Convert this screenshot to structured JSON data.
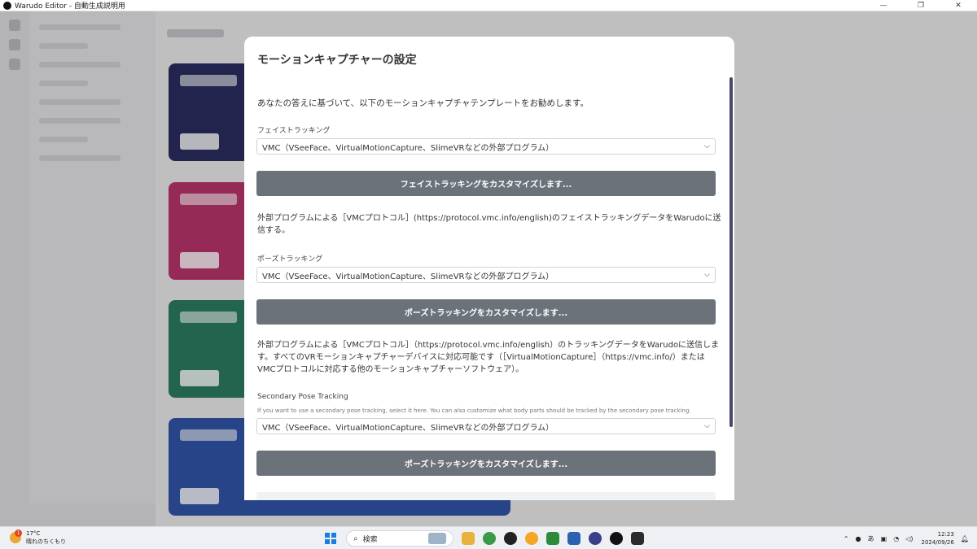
{
  "window": {
    "title": "Warudo Editor - 自動生成説明用",
    "controls": [
      "—",
      "❐",
      "✕"
    ]
  },
  "modal": {
    "title": "モーションキャプチャーの設定",
    "intro": "あなたの答えに基づいて、以下のモーションキャプチャテンプレートをお勧めします。",
    "face": {
      "label": "フェイストラッキング",
      "selected": "VMC（VSeeFace、VirtualMotionCapture、SlimeVRなどの外部プログラム）",
      "button": "フェイストラッキングをカスタマイズします...",
      "description": "外部プログラムによる［VMCプロトコル］(https://protocol.vmc.info/english)のフェイストラッキングデータをWarudoに送信する。"
    },
    "pose": {
      "label": "ポーズトラッキング",
      "selected": "VMC（VSeeFace、VirtualMotionCapture、SlimeVRなどの外部プログラム）",
      "button": "ポーズトラッキングをカスタマイズします...",
      "description": "外部プログラムによる［VMCプロトコル］（https://protocol.vmc.info/english）のトラッキングデータをWarudoに送信します。すべてのVRモーションキャプチャーデバイスに対応可能です（［VirtualMotionCapture］（https://vmc.info/）またはVMCプロトコルに対応する他のモーションキャプチャーソフトウェア）。"
    },
    "secondary": {
      "label": "Secondary Pose Tracking",
      "hint": "If you want to use a secondary pose tracking, select it here. You can also customize what body parts should be tracked by the secondary pose tracking.",
      "selected": "VMC（VSeeFace、VirtualMotionCapture、SlimeVRなどの外部プログラム）",
      "button": "ポーズトラッキングをカスタマイズします..."
    }
  },
  "taskbar": {
    "weather_temp": "17°C",
    "weather_desc": "晴れのちくもり",
    "weather_badge": "1",
    "search_placeholder": "検索",
    "ime": "あ",
    "time": "12:23",
    "date": "2024/09/26"
  },
  "colors": {
    "button_bg": "#6c727a",
    "card_1": "#2b2d5e",
    "card_2": "#b8346a",
    "card_3": "#2a7a5e",
    "card_4": "#3153a6"
  }
}
